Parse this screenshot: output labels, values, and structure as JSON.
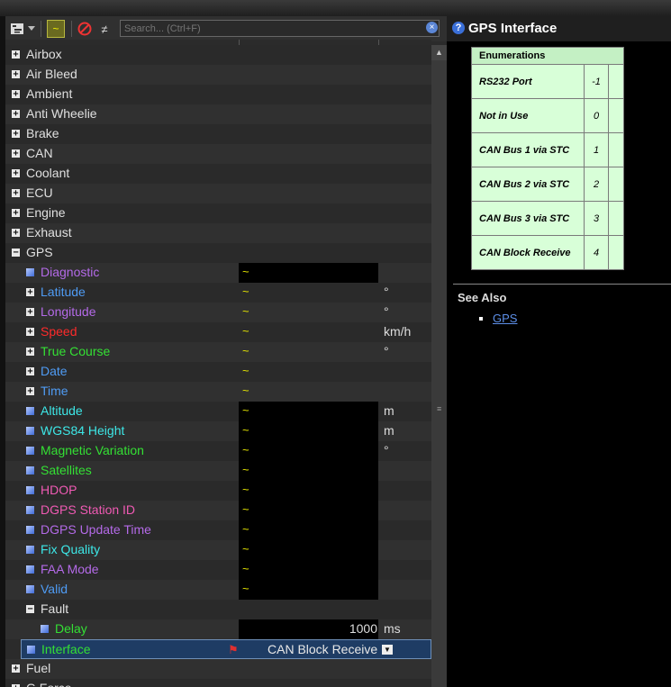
{
  "toolbar": {
    "search_placeholder": "Search... (Ctrl+F)",
    "clear_glyph": "×",
    "wave_glyph": "~",
    "noteq_glyph": "≠"
  },
  "tree": {
    "groups_top": [
      "Airbox",
      "Air Bleed",
      "Ambient",
      "Anti Wheelie",
      "Brake",
      "CAN",
      "Coolant",
      "ECU",
      "Engine",
      "Exhaust"
    ],
    "gps_label": "GPS",
    "gps_items": [
      {
        "label": "Diagnostic",
        "color": "#b46ae8",
        "kind": "leaf",
        "unit": "",
        "black": true
      },
      {
        "label": "Latitude",
        "color": "#4f9cf5",
        "kind": "node",
        "unit": "°",
        "black": false
      },
      {
        "label": "Longitude",
        "color": "#b46ae8",
        "kind": "node",
        "unit": "°",
        "black": false
      },
      {
        "label": "Speed",
        "color": "#ff2a2a",
        "kind": "node",
        "unit": "km/h",
        "black": false
      },
      {
        "label": "True Course",
        "color": "#34e034",
        "kind": "node",
        "unit": "°",
        "black": false
      },
      {
        "label": "Date",
        "color": "#4f9cf5",
        "kind": "node",
        "unit": "",
        "black": false
      },
      {
        "label": "Time",
        "color": "#4f9cf5",
        "kind": "node",
        "unit": "",
        "black": false
      },
      {
        "label": "Altitude",
        "color": "#3de8e8",
        "kind": "leaf",
        "unit": "m",
        "black": true
      },
      {
        "label": "WGS84 Height",
        "color": "#3de8e8",
        "kind": "leaf",
        "unit": "m",
        "black": true
      },
      {
        "label": "Magnetic Variation",
        "color": "#34e034",
        "kind": "leaf",
        "unit": "°",
        "black": true
      },
      {
        "label": "Satellites",
        "color": "#34e034",
        "kind": "leaf",
        "unit": "",
        "black": true
      },
      {
        "label": "HDOP",
        "color": "#f05ab4",
        "kind": "leaf",
        "unit": "",
        "black": true
      },
      {
        "label": "DGPS Station ID",
        "color": "#f05ab4",
        "kind": "leaf",
        "unit": "",
        "black": true
      },
      {
        "label": "DGPS Update Time",
        "color": "#b46ae8",
        "kind": "leaf",
        "unit": "",
        "black": true
      },
      {
        "label": "Fix Quality",
        "color": "#3de8e8",
        "kind": "leaf",
        "unit": "",
        "black": true
      },
      {
        "label": "FAA Mode",
        "color": "#b46ae8",
        "kind": "leaf",
        "unit": "",
        "black": true
      },
      {
        "label": "Valid",
        "color": "#4f9cf5",
        "kind": "leaf",
        "unit": "",
        "black": true
      }
    ],
    "fault": {
      "label": "Fault",
      "delay_label": "Delay",
      "delay_value": "1000",
      "delay_unit": "ms",
      "delay_color": "#34e034"
    },
    "interface": {
      "label": "Interface",
      "value": "CAN Block Receive",
      "color": "#34e034"
    },
    "groups_bottom": [
      "Fuel",
      "G Force"
    ]
  },
  "help": {
    "title": "GPS Interface",
    "enum_header": "Enumerations",
    "enums": [
      {
        "name": "RS232 Port",
        "value": "-1"
      },
      {
        "name": "Not in Use",
        "value": "0"
      },
      {
        "name": "CAN Bus 1 via STC",
        "value": "1"
      },
      {
        "name": "CAN Bus 2 via STC",
        "value": "2"
      },
      {
        "name": "CAN Bus 3 via STC",
        "value": "3"
      },
      {
        "name": "CAN Block Receive",
        "value": "4"
      }
    ],
    "see_also": "See Also",
    "link": "GPS"
  }
}
